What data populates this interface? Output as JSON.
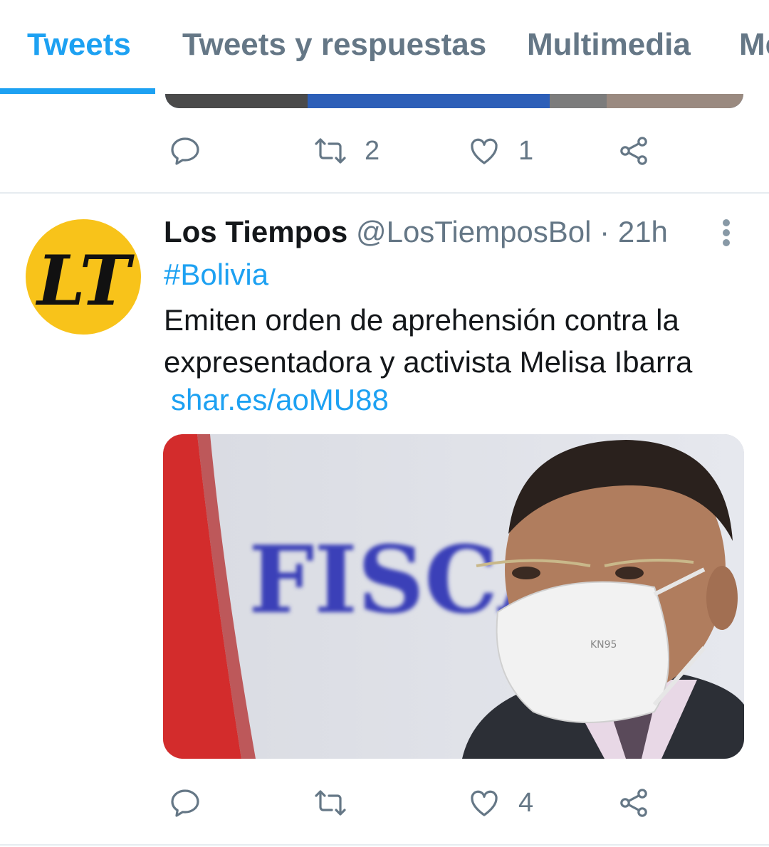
{
  "tabs": [
    {
      "label": "Tweets",
      "active": true
    },
    {
      "label": "Tweets y respuestas",
      "active": false
    },
    {
      "label": "Multimedia",
      "active": false
    },
    {
      "label": "Me",
      "active": false
    }
  ],
  "previous_tweet": {
    "actions": {
      "reply_icon": "reply-icon",
      "retweet_count": "2",
      "like_count": "1",
      "share_icon": "share-icon"
    }
  },
  "tweet": {
    "author_name": "Los Tiempos",
    "handle": "@LosTiemposBol",
    "separator": "·",
    "time": "21h",
    "avatar_text": "LT",
    "hashtag": "#Bolivia",
    "text": "Emiten orden de aprehensión contra la expresentadora y activista Melisa Ibarra",
    "link": "shar.es/aoMU88",
    "media": {
      "sign_text": "FISCAL",
      "mask_text": "KN95"
    },
    "actions": {
      "retweet_count": "",
      "like_count": "4"
    }
  },
  "colors": {
    "accent": "#1da1f2",
    "muted": "#657786",
    "avatar_bg": "#f8c31a"
  }
}
